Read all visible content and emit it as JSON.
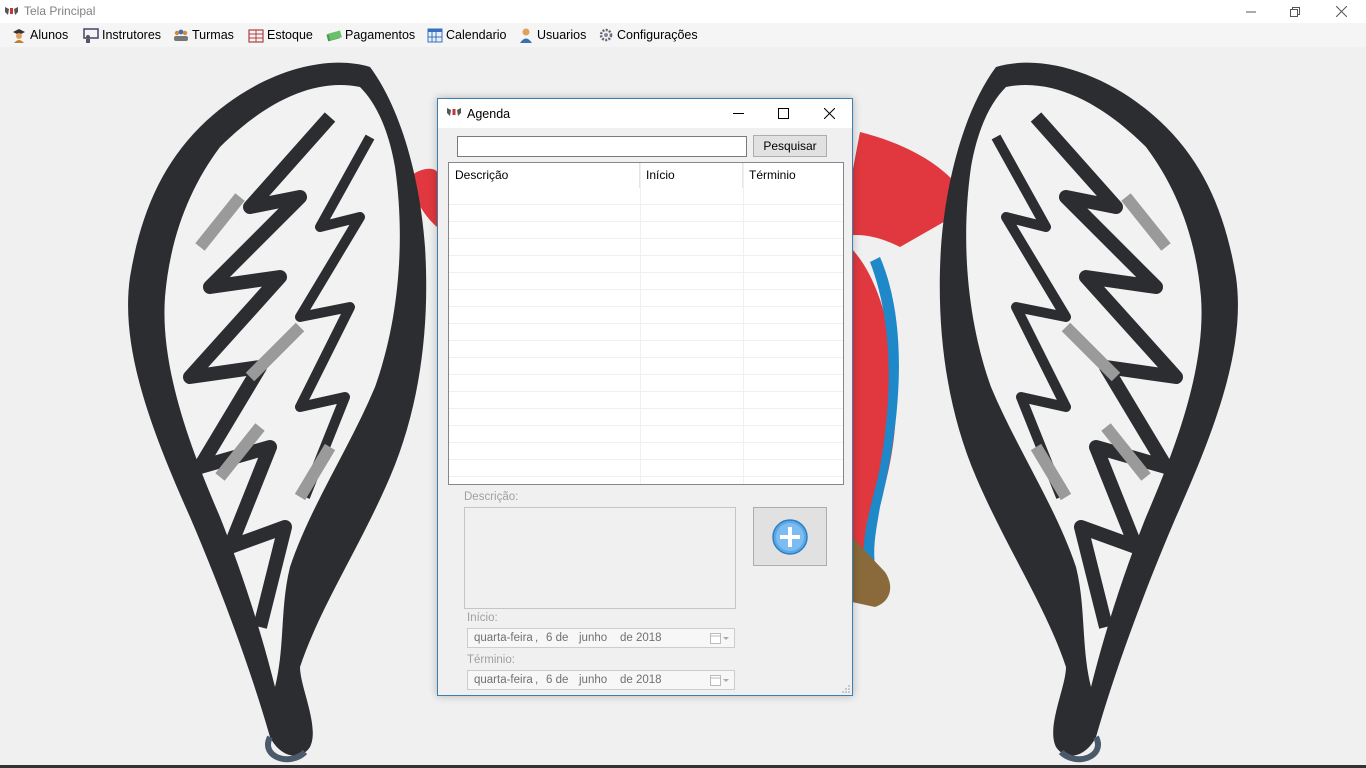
{
  "window": {
    "title": "Tela Principal"
  },
  "menu": {
    "items": [
      {
        "label": "Alunos",
        "icon": "student-icon"
      },
      {
        "label": "Instrutores",
        "icon": "instructor-icon"
      },
      {
        "label": "Turmas",
        "icon": "group-icon"
      },
      {
        "label": "Estoque",
        "icon": "stock-icon"
      },
      {
        "label": "Pagamentos",
        "icon": "money-icon"
      },
      {
        "label": "Calendario",
        "icon": "calendar-icon"
      },
      {
        "label": "Usuarios",
        "icon": "user-icon"
      },
      {
        "label": "Configurações",
        "icon": "gear-icon"
      }
    ]
  },
  "dialog": {
    "title": "Agenda",
    "search": {
      "value": "",
      "button_label": "Pesquisar"
    },
    "table": {
      "columns": [
        "Descrição",
        "Início",
        "Términio"
      ],
      "rows": []
    },
    "form": {
      "description_label": "Descrição:",
      "description_value": "",
      "start_label": "Início:",
      "end_label": "Términio:",
      "start_date": {
        "weekday": "quarta-feira",
        "sep": ",",
        "day": "6 de",
        "month": "junho",
        "year": "de 2018"
      },
      "end_date": {
        "weekday": "quarta-feira",
        "sep": ",",
        "day": "6 de",
        "month": "junho",
        "year": "de 2018"
      },
      "add_button_icon": "plus-circle-icon"
    }
  },
  "colors": {
    "accent_border": "#3c7fb1",
    "add_icon": "#5aa9e6"
  }
}
